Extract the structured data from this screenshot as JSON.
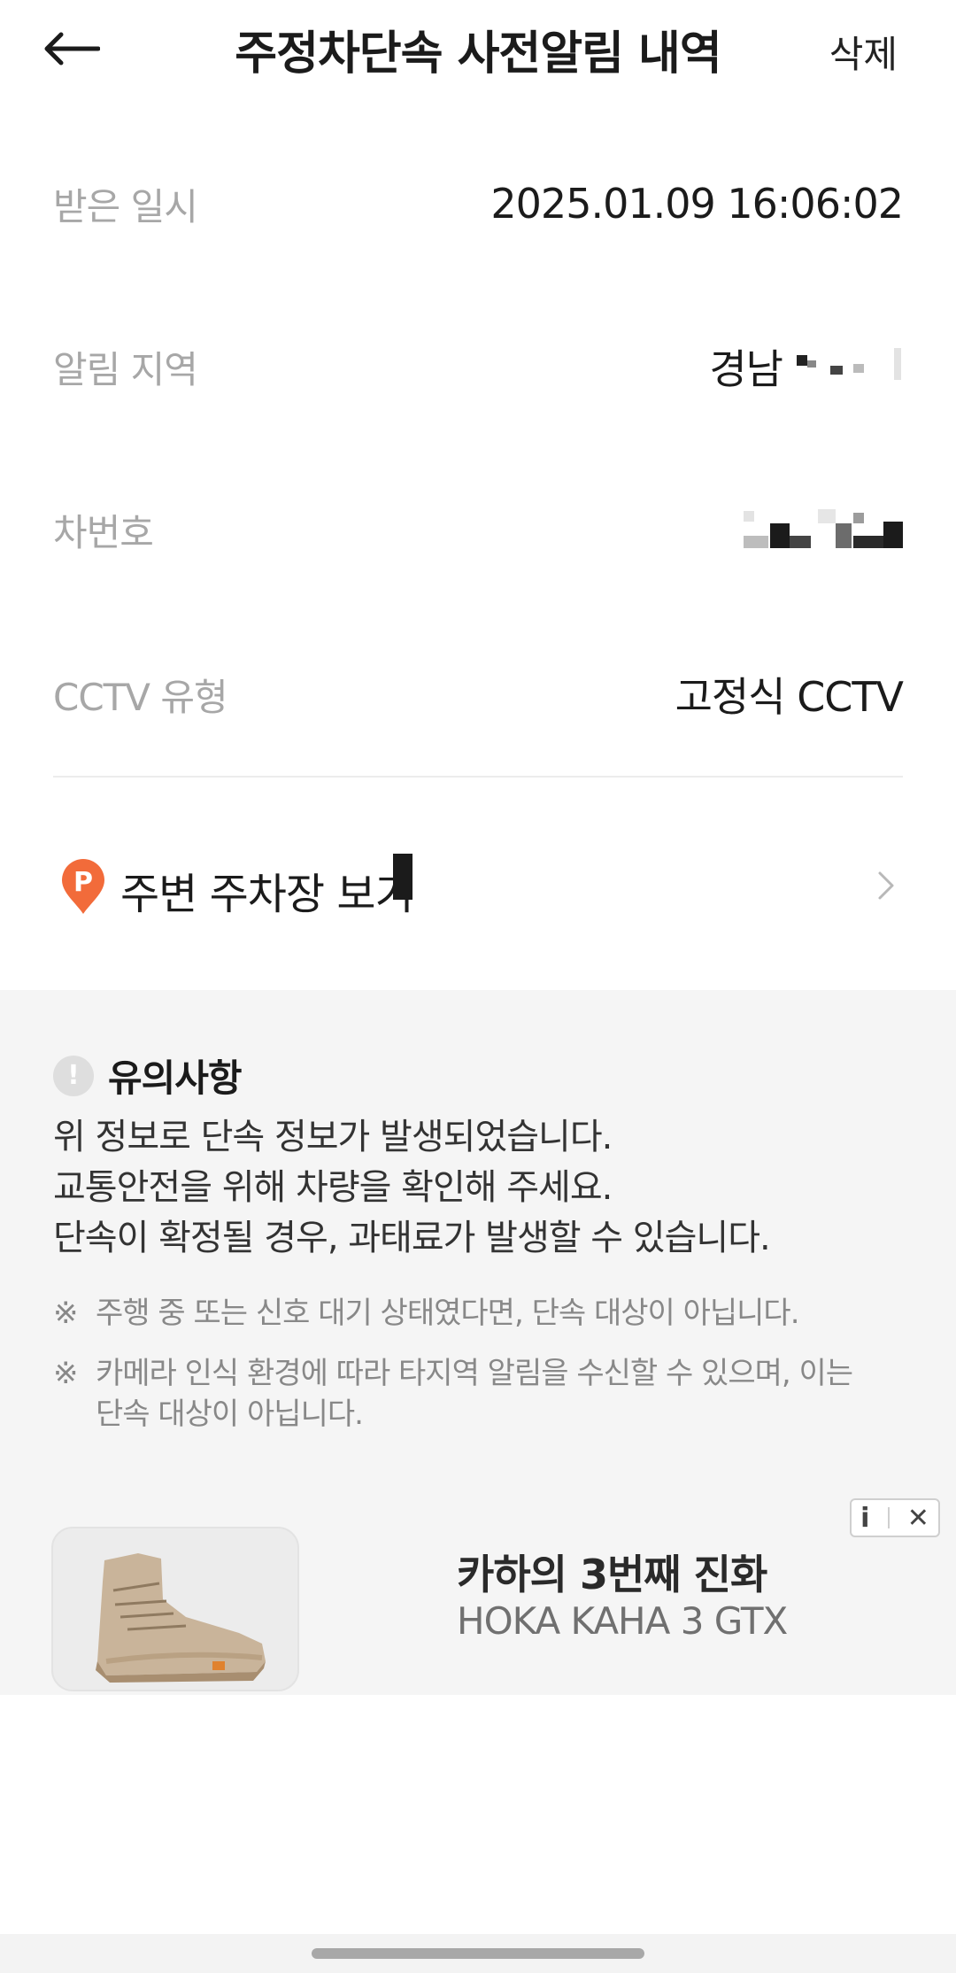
{
  "header": {
    "back_icon": "arrow-left-icon",
    "title": "주정차단속 사전알림 내역",
    "delete_label": "삭제"
  },
  "info": {
    "received": {
      "label": "받은 일시",
      "value": "2025.01.09 16:06:02"
    },
    "region": {
      "label": "알림 지역",
      "value": "경남"
    },
    "plate": {
      "label": "차번호"
    },
    "cctv": {
      "label": "CCTV 유형",
      "value": "고정식 CCTV"
    }
  },
  "parking": {
    "icon": "parking-pin-icon",
    "label": "주변 주차장 보기",
    "chevron": "chevron-right-icon"
  },
  "notice": {
    "icon": "alert-icon",
    "title": "유의사항",
    "lines": [
      "위 정보로 단속 정보가 발생되었습니다.",
      "교통안전을 위해 차량을 확인해 주세요.",
      "단속이 확정될 경우, 과태료가 발생할 수 있습니다."
    ],
    "footnotes": [
      {
        "mark": "※",
        "text": "주행 중 또는 신호 대기 상태였다면, 단속 대상이 아닙니다."
      },
      {
        "mark": "※",
        "text": "카메라 인식 환경에 따라 타지역 알림을 수신할 수 있으며, 이는 단속 대상이 아닙니다."
      }
    ]
  },
  "ad": {
    "title": "카하의 3번째 진화",
    "subtitle": "HOKA KAHA 3 GTX",
    "info_glyph": "i",
    "close_glyph": "✕"
  },
  "colors": {
    "accent_orange": "#f26b3a",
    "label_gray": "#a7a7a7",
    "notice_bg": "#f5f5f5"
  }
}
